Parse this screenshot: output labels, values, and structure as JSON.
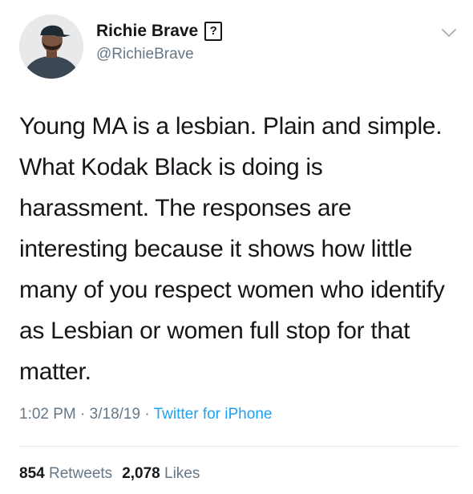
{
  "tweet": {
    "author": {
      "display_name": "Richie Brave",
      "badge": "?",
      "handle": "@RichieBrave"
    },
    "text": "Young MA is a lesbian. Plain and simple. What Kodak Black is doing is harassment. The responses are interesting because it shows how little many of you respect women who identify as Lesbian or women full stop for that matter.",
    "time": "1:02 PM",
    "date": "3/18/19",
    "source": "Twitter for iPhone",
    "separator": " · ",
    "retweets_count": "854",
    "retweets_label": "Retweets",
    "likes_count": "2,078",
    "likes_label": "Likes"
  },
  "icons": {
    "menu": "chevron-down-icon",
    "avatar": "avatar"
  },
  "colors": {
    "text": "#14171a",
    "muted": "#657786",
    "link": "#1da1f2",
    "divider": "#e1e8ed"
  }
}
